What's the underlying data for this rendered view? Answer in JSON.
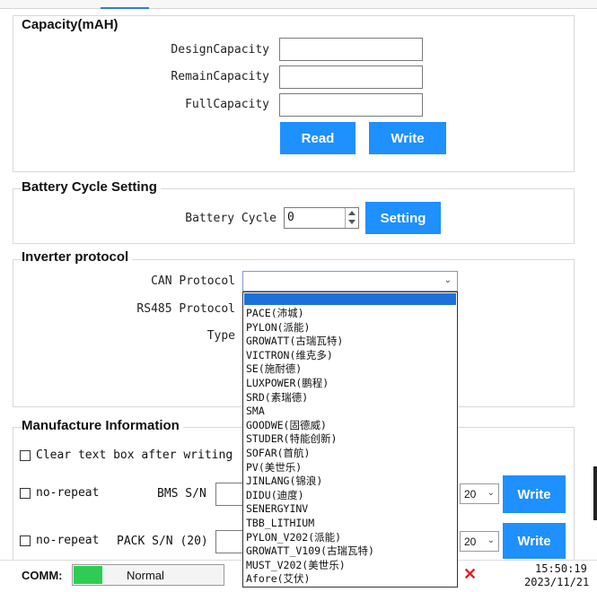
{
  "capacity": {
    "title": "Capacity(mAH)",
    "design_label": "DesignCapacity",
    "design_value": "",
    "remain_label": "RemainCapacity",
    "remain_value": "",
    "full_label": "FullCapacity",
    "full_value": "",
    "read_button": "Read",
    "write_button": "Write"
  },
  "cycle": {
    "title": "Battery Cycle Setting",
    "label": "Battery Cycle",
    "value": "0",
    "button": "Setting"
  },
  "inverter": {
    "title": "Inverter protocol",
    "can_label": "CAN Protocol",
    "can_value": "",
    "rs485_label": "RS485 Protocol",
    "type_label": "Type",
    "options": [
      "PACE(沛城)",
      "PYLON(派能)",
      "GROWATT(古瑞瓦特)",
      "VICTRON(维克多)",
      "SE(施耐德)",
      "LUXPOWER(鹏程)",
      "SRD(素瑞德)",
      "SMA",
      "GOODWE(固德威)",
      "STUDER(特能创新)",
      "SOFAR(首航)",
      "PV(美世乐)",
      "JINLANG(锦浪)",
      "DIDU(迪度)",
      "SENERGYINV",
      "TBB_LITHIUM",
      "PYLON_V202(派能)",
      "GROWATT_V109(古瑞瓦特)",
      "MUST_V202(美世乐)",
      "Afore(艾伏)"
    ]
  },
  "manufacture": {
    "title": "Manufacture Information",
    "clear_label": "Clear text box after writing",
    "norepeat1_label": "no-repeat",
    "bms_label": "BMS S/N",
    "bms_len": "20",
    "bms_write": "Write",
    "norepeat2_label": "no-repeat",
    "pack_label": "PACK S/N (20)",
    "pack_len": "20",
    "pack_write": "Write"
  },
  "status": {
    "comm_label": "COMM:",
    "comm_state": "Normal",
    "time": "15:50:19",
    "date": "2023/11/21"
  },
  "colors": {
    "accent": "#1e90ff",
    "comm_green": "#2ecc55"
  }
}
